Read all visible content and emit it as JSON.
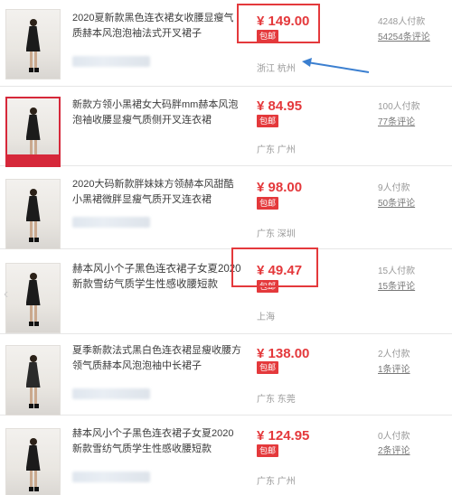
{
  "items": [
    {
      "title": "2020夏新款黑色连衣裙女收腰显瘦气质赫本风泡泡袖法式开叉裙子",
      "price": "¥ 149.00",
      "badge": "包邮",
      "location": "浙江 杭州",
      "paid": "4248人付款",
      "reviews": "54254条评论"
    },
    {
      "title": "新款方领小黑裙女大码胖mm赫本风泡泡袖收腰显瘦气质侧开叉连衣裙",
      "price": "¥ 84.95",
      "badge": "包邮",
      "location": "广东 广州",
      "paid": "100人付款",
      "reviews": "77条评论"
    },
    {
      "title": "2020大码新款胖妹妹方领赫本风甜酷小黑裙微胖显瘦气质开叉连衣裙",
      "price": "¥ 98.00",
      "badge": "包邮",
      "location": "广东 深圳",
      "paid": "9人付款",
      "reviews": "50条评论"
    },
    {
      "title": "赫本风小个子黑色连衣裙子女夏2020新款雪纺气质学生性感收腰短款",
      "price": "¥ 49.47",
      "badge": "包邮",
      "location": "上海",
      "paid": "15人付款",
      "reviews": "15条评论"
    },
    {
      "title": "夏季新款法式黑白色连衣裙显瘦收腰方领气质赫本风泡泡袖中长裙子",
      "price": "¥ 138.00",
      "badge": "包邮",
      "location": "广东 东莞",
      "paid": "2人付款",
      "reviews": "1条评论"
    },
    {
      "title": "赫本风小个子黑色连衣裙子女夏2020新款雪纺气质学生性感收腰短款",
      "price": "¥ 124.95",
      "badge": "包邮",
      "location": "广东 广州",
      "paid": "0人付款",
      "reviews": "2条评论"
    }
  ],
  "colors": {
    "price": "#e4393c",
    "highlight": "#e4393c",
    "arrow": "#3b7fd0"
  }
}
